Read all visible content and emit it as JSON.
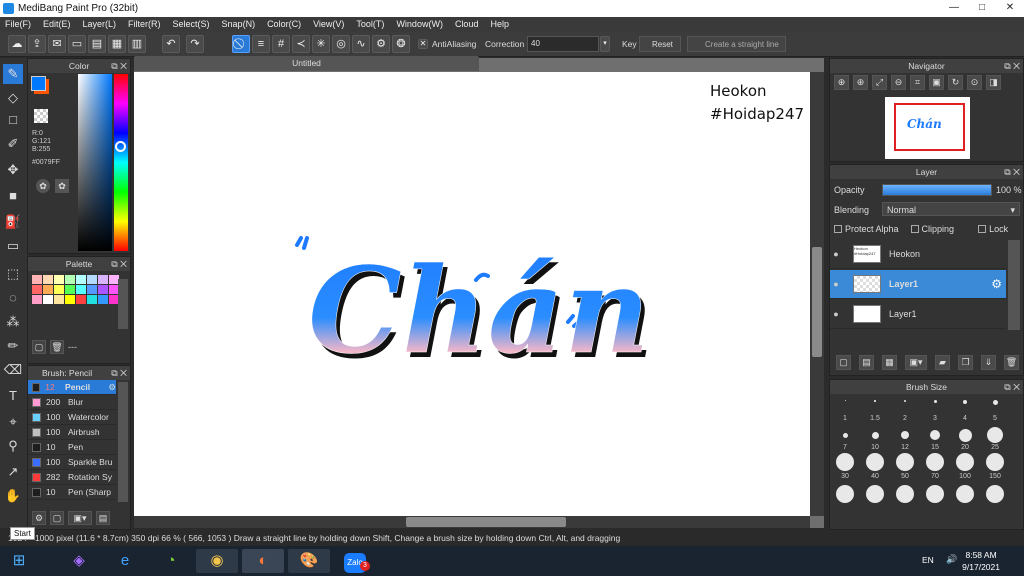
{
  "window": {
    "title": "MediBang Paint Pro (32bit)",
    "minimize": "—",
    "maximize": "□",
    "close": "✕"
  },
  "menu": [
    "File(F)",
    "Edit(E)",
    "Layer(L)",
    "Filter(R)",
    "Select(S)",
    "Snap(N)",
    "Color(C)",
    "View(V)",
    "Tool(T)",
    "Window(W)",
    "Cloud",
    "Help"
  ],
  "toolbar": {
    "antialiasing": "AntiAliasing",
    "correction_label": "Correction",
    "correction_value": "40",
    "key": "Key",
    "reset": "Reset",
    "straight_line": "Create a straight line"
  },
  "color_panel": {
    "title": "Color",
    "r": "R:0",
    "g": "G:121",
    "b": "B:255",
    "hex": "#0079FF"
  },
  "palette_panel": {
    "title": "Palette",
    "dash": "---",
    "swatches": [
      "#ffb3b3",
      "#ffd9b3",
      "#ffffb3",
      "#b3ffb3",
      "#b3ffff",
      "#b3d9ff",
      "#d9b3ff",
      "#ffb3ff",
      "#ff6666",
      "#ffaa55",
      "#ffff55",
      "#55ff55",
      "#55ffff",
      "#5599ff",
      "#aa55ff",
      "#ff55ff",
      "#ff9fc8",
      "#ffffff",
      "#ffe6a0",
      "#ffff00",
      "#ff4040",
      "#22e0e0",
      "#3399ff",
      "#ff33cc"
    ]
  },
  "brush_panel": {
    "title": "Brush: Pencil",
    "items": [
      {
        "size": "12",
        "name": "Pencil",
        "color": "#1e1e1e"
      },
      {
        "size": "200",
        "name": "Blur",
        "color": "#ff9ad5"
      },
      {
        "size": "100",
        "name": "Watercolor",
        "color": "#6ad0ff"
      },
      {
        "size": "100",
        "name": "Airbrush",
        "color": "#c0c0c0"
      },
      {
        "size": "10",
        "name": "Pen",
        "color": "#1e1e1e"
      },
      {
        "size": "100",
        "name": "Sparkle Bru",
        "color": "#3a6cff"
      },
      {
        "size": "282",
        "name": "Rotation Sy",
        "color": "#ff3a3a"
      },
      {
        "size": "10",
        "name": "Pen (Sharp",
        "color": "#1e1e1e"
      }
    ]
  },
  "canvas": {
    "tab": "Untitled",
    "watermark_line1": "Heokon",
    "watermark_line2": "#Hoidap247",
    "artwork_text": "Chán"
  },
  "navigator": {
    "title": "Navigator"
  },
  "layer_panel": {
    "title": "Layer",
    "opacity_label": "Opacity",
    "opacity_value": "100 %",
    "opacity_fraction": 1.0,
    "blending_label": "Blending",
    "blending_value": "Normal",
    "protect_alpha": "Protect Alpha",
    "clipping": "Clipping",
    "lock": "Lock",
    "layers": [
      {
        "name": "Heokon",
        "thumb": "Heokon #Hoidap247",
        "selected": false
      },
      {
        "name": "Layer1",
        "thumb": "",
        "selected": true
      },
      {
        "name": "Layer1",
        "thumb": "",
        "selected": false
      }
    ]
  },
  "brush_size_panel": {
    "title": "Brush Size",
    "sizes": [
      "1",
      "1.5",
      "2",
      "3",
      "4",
      "5",
      "7",
      "10",
      "12",
      "15",
      "20",
      "25",
      "30",
      "40",
      "50",
      "70",
      "100",
      "150",
      "",
      "",
      "",
      "",
      "",
      ""
    ]
  },
  "status": {
    "text": "1024 * 1000 pixel  (11.6 * 8.7cm)  350 dpi  66 %  ( 566, 1053 )  Draw a straight line by holding down Shift, Change a brush size by holding down Ctrl, Alt, and dragging",
    "tooltip": "Start"
  },
  "taskbar": {
    "lang": "EN",
    "time": "8:58 AM",
    "date": "9/17/2021",
    "zalo": "Zalo",
    "badge": "3"
  }
}
